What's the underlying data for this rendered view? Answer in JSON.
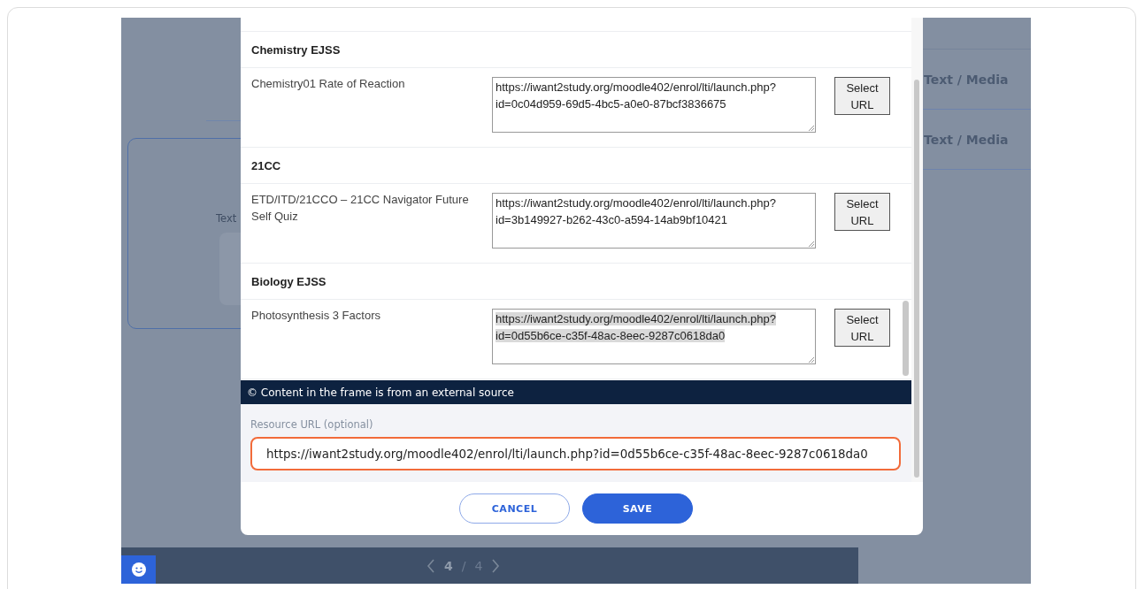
{
  "background": {
    "card_label": "Text",
    "side_items": [
      {
        "label": "Text / Media"
      },
      {
        "label": "Text / Media"
      }
    ],
    "pager": {
      "current": "4",
      "separator": "/",
      "total": "4"
    }
  },
  "dialog": {
    "sections": [
      {
        "title": "Chemistry EJSS",
        "items": [
          {
            "name": "Chemistry01 Rate of Reaction",
            "url": "https://iwant2study.org/moodle402/enrol/lti/launch.php?id=0c04d959-69d5-4bc5-a0e0-87bcf3836675",
            "text_selected": false,
            "button": "Select URL"
          }
        ]
      },
      {
        "title": "21CC",
        "items": [
          {
            "name": "ETD/ITD/21CCO – 21CC Navigator Future Self Quiz",
            "url": "https://iwant2study.org/moodle402/enrol/lti/launch.php?id=3b149927-b262-43c0-a594-14ab9bf10421",
            "text_selected": false,
            "button": "Select URL"
          }
        ]
      },
      {
        "title": "Biology EJSS",
        "items": [
          {
            "name": "Photosynthesis 3 Factors",
            "url": "https://iwant2study.org/moodle402/enrol/lti/launch.php?id=0d55b6ce-c35f-48ac-8eec-9287c0618da0",
            "text_selected": true,
            "button": "Select URL"
          }
        ]
      }
    ],
    "notice": "© Content in the frame is from an external source",
    "resource_url": {
      "label": "Resource URL (optional)",
      "value": "https://iwant2study.org/moodle402/enrol/lti/launch.php?id=0d55b6ce-c35f-48ac-8eec-9287c0618da0",
      "focused": true
    },
    "buttons": [
      {
        "label": "CANCEL",
        "kind": "secondary"
      },
      {
        "label": "SAVE",
        "kind": "primary"
      }
    ]
  }
}
